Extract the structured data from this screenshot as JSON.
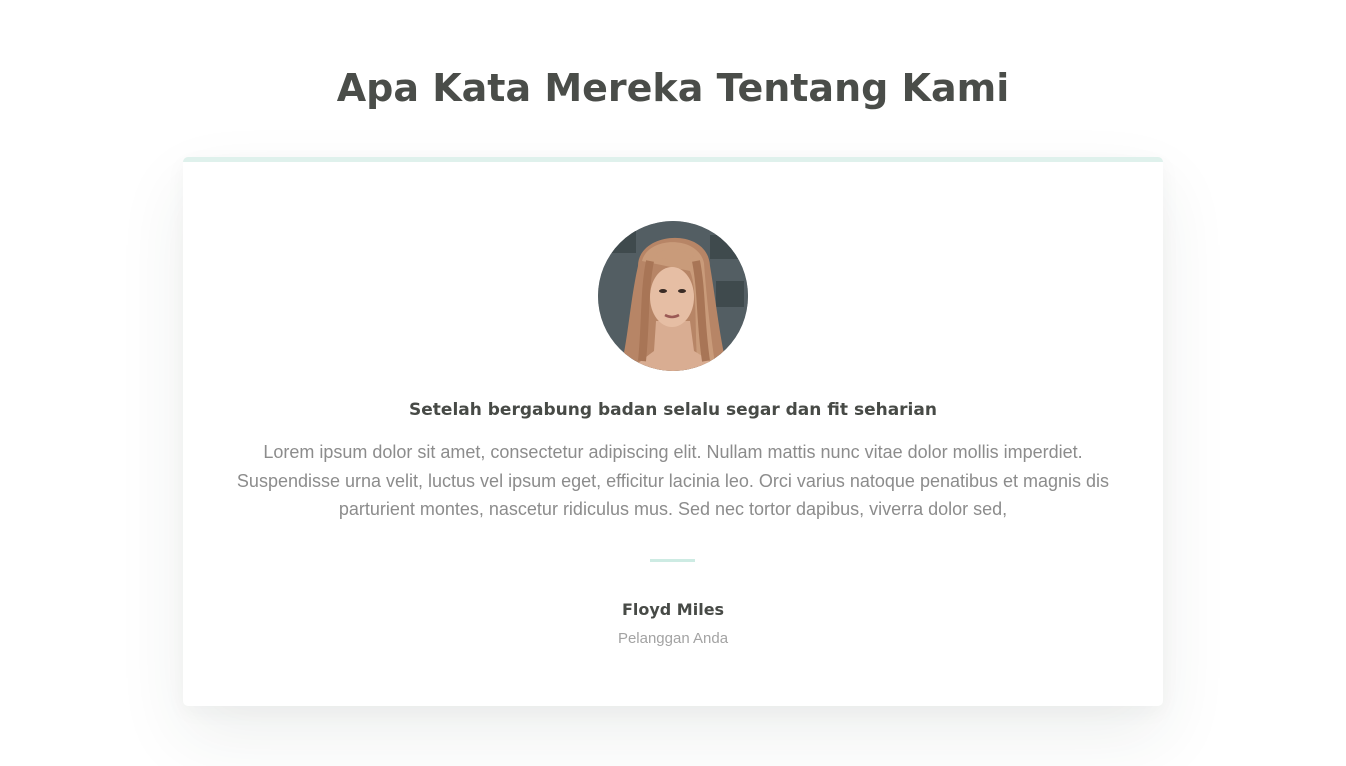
{
  "section": {
    "title": "Apa Kata Mereka Tentang Kami"
  },
  "testimonial": {
    "avatar_icon": "avatar-photo",
    "headline": "Setelah bergabung badan selalu segar dan fit seharian",
    "quote": "Lorem ipsum dolor sit amet, consectetur adipiscing elit. Nullam mattis nunc vitae dolor mollis imperdiet. Suspendisse urna velit, luctus vel ipsum eget, efficitur lacinia leo. Orci varius natoque penatibus et magnis dis parturient montes, nascetur ridiculus mus. Sed nec tortor dapibus, viverra dolor sed,",
    "author_name": "Floyd Miles",
    "author_role": "Pelanggan Anda"
  },
  "colors": {
    "heading": "#4a4d49",
    "body_text": "#8c8c8c",
    "accent": "#dff1ec",
    "divider": "#cdebe3"
  }
}
